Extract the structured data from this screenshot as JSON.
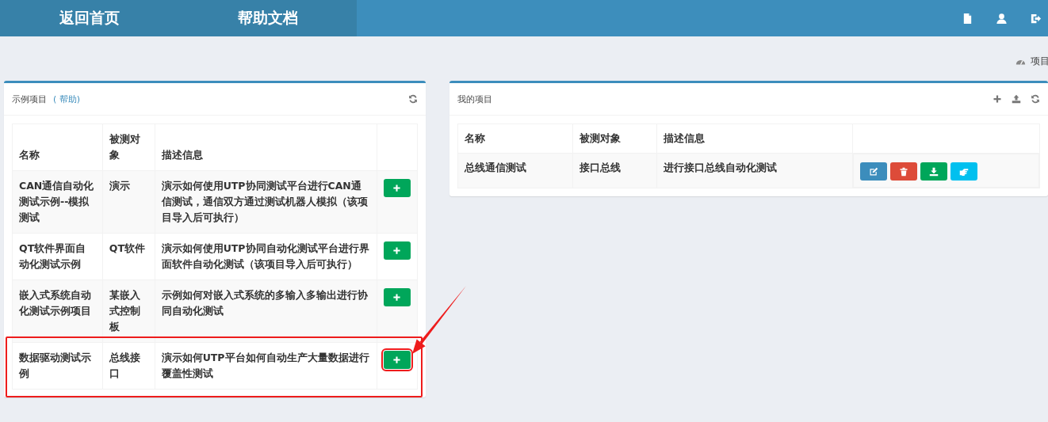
{
  "nav": {
    "links": [
      "返回首页",
      "帮助文档"
    ],
    "icons": [
      {
        "kind": "document"
      },
      {
        "kind": "user"
      },
      {
        "kind": "logout"
      }
    ]
  },
  "breadcrumb": {
    "text": "项目"
  },
  "sample_panel": {
    "title": "示例项目",
    "help_link": "( 帮助)",
    "columns": [
      "名称",
      "被测对象",
      "描述信息"
    ],
    "rows": [
      {
        "name": "CAN通信自动化测试示例--模拟测试",
        "target": "演示",
        "description": "演示如何使用UTP协同测试平台进行CAN通信测试，通信双方通过测试机器人模拟（该项目导入后可执行）",
        "highlighted": false
      },
      {
        "name": "QT软件界面自动化测试示例",
        "target": "QT软件",
        "description": "演示如何使用UTP协同自动化测试平台进行界面软件自动化测试（该项目导入后可执行）",
        "highlighted": false
      },
      {
        "name": "嵌入式系统自动化测试示例项目",
        "target": "某嵌入式控制板",
        "description": "示例如何对嵌入式系统的多输入多输出进行协同自动化测试",
        "highlighted": false
      },
      {
        "name": "数据驱动测试示例",
        "target": "总线接口",
        "description": "演示如何UTP平台如何自动生产大量数据进行覆盖性测试",
        "highlighted": true
      }
    ]
  },
  "my_panel": {
    "title": "我的项目",
    "columns": [
      "名称",
      "被测对象",
      "描述信息"
    ],
    "rows": [
      {
        "name": "总线通信测试",
        "target": "接口总线",
        "description": "进行接口总线自动化测试",
        "actions": [
          {
            "kind": "edit"
          },
          {
            "kind": "delete"
          },
          {
            "kind": "download"
          },
          {
            "kind": "share"
          }
        ]
      }
    ]
  }
}
